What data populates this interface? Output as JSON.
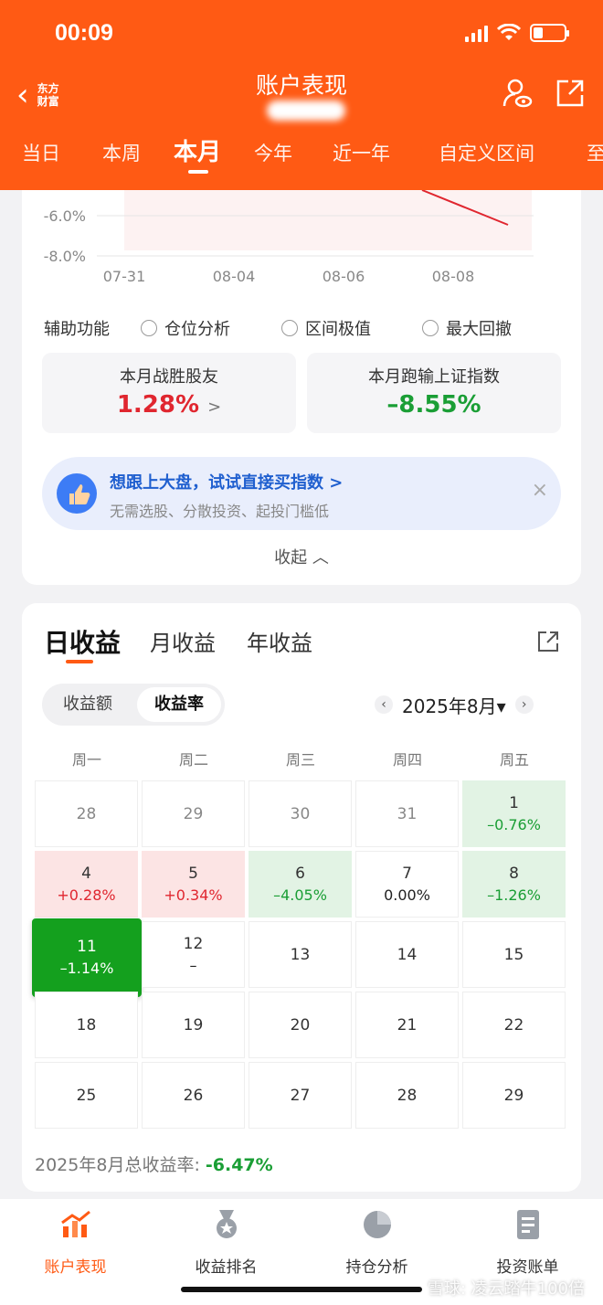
{
  "status": {
    "time": "00:09"
  },
  "header": {
    "title": "账户表现",
    "logo_line1": "东方",
    "logo_line2": "财富",
    "tabs": [
      "当日",
      "本周",
      "本月",
      "今年",
      "近一年",
      "自定义区间",
      "至"
    ],
    "active_tab": "本月"
  },
  "chart": {
    "y_ticks": [
      "-6.0%",
      "-8.0%"
    ],
    "x_ticks": [
      "07-31",
      "08-04",
      "08-06",
      "08-08"
    ]
  },
  "aux": {
    "label": "辅助功能",
    "options": [
      "仓位分析",
      "区间极值",
      "最大回撤"
    ]
  },
  "stats": [
    {
      "label": "本月战胜股友",
      "value": "1.28%",
      "suffix": ">"
    },
    {
      "label": "本月跑输上证指数",
      "value": "–8.55%"
    }
  ],
  "promo": {
    "title": "想跟上大盘，试试直接买指数 >",
    "subtitle": "无需选股、分散投资、起投门槛低",
    "close": "×"
  },
  "collapse_label": "收起 ︿",
  "profit": {
    "tabs": [
      "日收益",
      "月收益",
      "年收益"
    ],
    "active_tab": "日收益",
    "segments": [
      "收益额",
      "收益率"
    ],
    "active_segment": "收益率",
    "prev": "‹",
    "next": "›",
    "month": "2025年8月▾",
    "weekdays": [
      "周一",
      "周二",
      "周三",
      "周四",
      "周五"
    ],
    "calendar": [
      {
        "day": "28",
        "value": "",
        "state": "prev"
      },
      {
        "day": "29",
        "value": "",
        "state": "prev"
      },
      {
        "day": "30",
        "value": "",
        "state": "prev"
      },
      {
        "day": "31",
        "value": "",
        "state": "prev"
      },
      {
        "day": "1",
        "value": "–0.76%",
        "state": "down"
      },
      {
        "day": "4",
        "value": "+0.28%",
        "state": "up"
      },
      {
        "day": "5",
        "value": "+0.34%",
        "state": "up"
      },
      {
        "day": "6",
        "value": "–4.05%",
        "state": "down"
      },
      {
        "day": "7",
        "value": "0.00%",
        "state": "flat"
      },
      {
        "day": "8",
        "value": "–1.26%",
        "state": "down"
      },
      {
        "day": "11",
        "value": "–1.14%",
        "state": "sel"
      },
      {
        "day": "12",
        "value": "–",
        "state": "flat"
      },
      {
        "day": "13",
        "value": "",
        "state": "solo"
      },
      {
        "day": "14",
        "value": "",
        "state": "solo"
      },
      {
        "day": "15",
        "value": "",
        "state": "solo"
      },
      {
        "day": "18",
        "value": "",
        "state": "solo"
      },
      {
        "day": "19",
        "value": "",
        "state": "solo"
      },
      {
        "day": "20",
        "value": "",
        "state": "solo"
      },
      {
        "day": "21",
        "value": "",
        "state": "solo"
      },
      {
        "day": "22",
        "value": "",
        "state": "solo"
      },
      {
        "day": "25",
        "value": "",
        "state": "solo"
      },
      {
        "day": "26",
        "value": "",
        "state": "solo"
      },
      {
        "day": "27",
        "value": "",
        "state": "solo"
      },
      {
        "day": "28",
        "value": "",
        "state": "solo"
      },
      {
        "day": "29",
        "value": "",
        "state": "solo"
      }
    ],
    "total_label": "2025年8月总收益率:",
    "total_value": "-6.47%"
  },
  "bottom_nav": [
    {
      "label": "账户表现",
      "icon": "chart-trend-icon"
    },
    {
      "label": "收益排名",
      "icon": "medal-icon"
    },
    {
      "label": "持仓分析",
      "icon": "pie-chart-icon"
    },
    {
      "label": "投资账单",
      "icon": "document-icon"
    }
  ],
  "watermark": "雪球: 凌云踏牛100倍",
  "colors": {
    "brand": "#ff5a14",
    "up": "#e0262f",
    "down": "#1a9e35",
    "selected": "#14a01e"
  }
}
